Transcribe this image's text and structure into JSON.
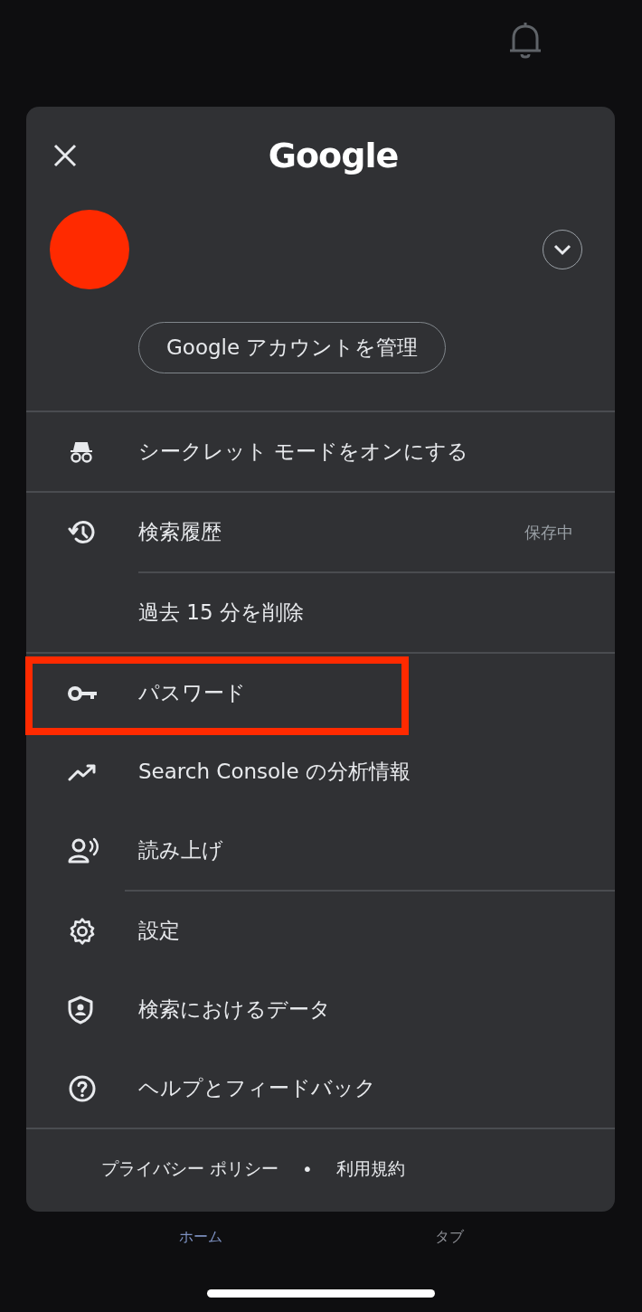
{
  "background": {
    "bottom_nav": [
      {
        "label": "ホーム",
        "selected": true
      },
      {
        "label": "タブ",
        "selected": false
      }
    ]
  },
  "dialog": {
    "title": "Google",
    "manage_account_button": "Google アカウントを管理",
    "menu": [
      {
        "kind": "item",
        "label": "シークレット モードをオンにする",
        "highlighted": false,
        "divider_after": true,
        "divider_inset": false
      },
      {
        "kind": "item",
        "label": "検索履歴",
        "trailing": "保存中",
        "highlighted": false,
        "divider_after": true,
        "divider_inset": true
      },
      {
        "kind": "sub",
        "label": "過去 15 分を削除",
        "highlighted": false,
        "divider_after": true,
        "divider_inset": false
      },
      {
        "kind": "item",
        "label": "パスワード",
        "highlighted": true,
        "divider_after": false
      },
      {
        "kind": "item",
        "label": "Search Console の分析情報",
        "highlighted": false,
        "divider_after": false
      },
      {
        "kind": "item",
        "label": "読み上げ",
        "highlighted": false,
        "divider_after": true,
        "divider_inset": true
      },
      {
        "kind": "item",
        "label": "設定",
        "highlighted": false,
        "divider_after": false
      },
      {
        "kind": "item",
        "label": "検索におけるデータ",
        "highlighted": false,
        "divider_after": false
      },
      {
        "kind": "item",
        "label": "ヘルプとフィードバック",
        "highlighted": false,
        "divider_after": true,
        "divider_inset": false
      }
    ],
    "footer_links": [
      "プライバシー ポリシー",
      "利用規約"
    ],
    "footer_separator": "•"
  }
}
